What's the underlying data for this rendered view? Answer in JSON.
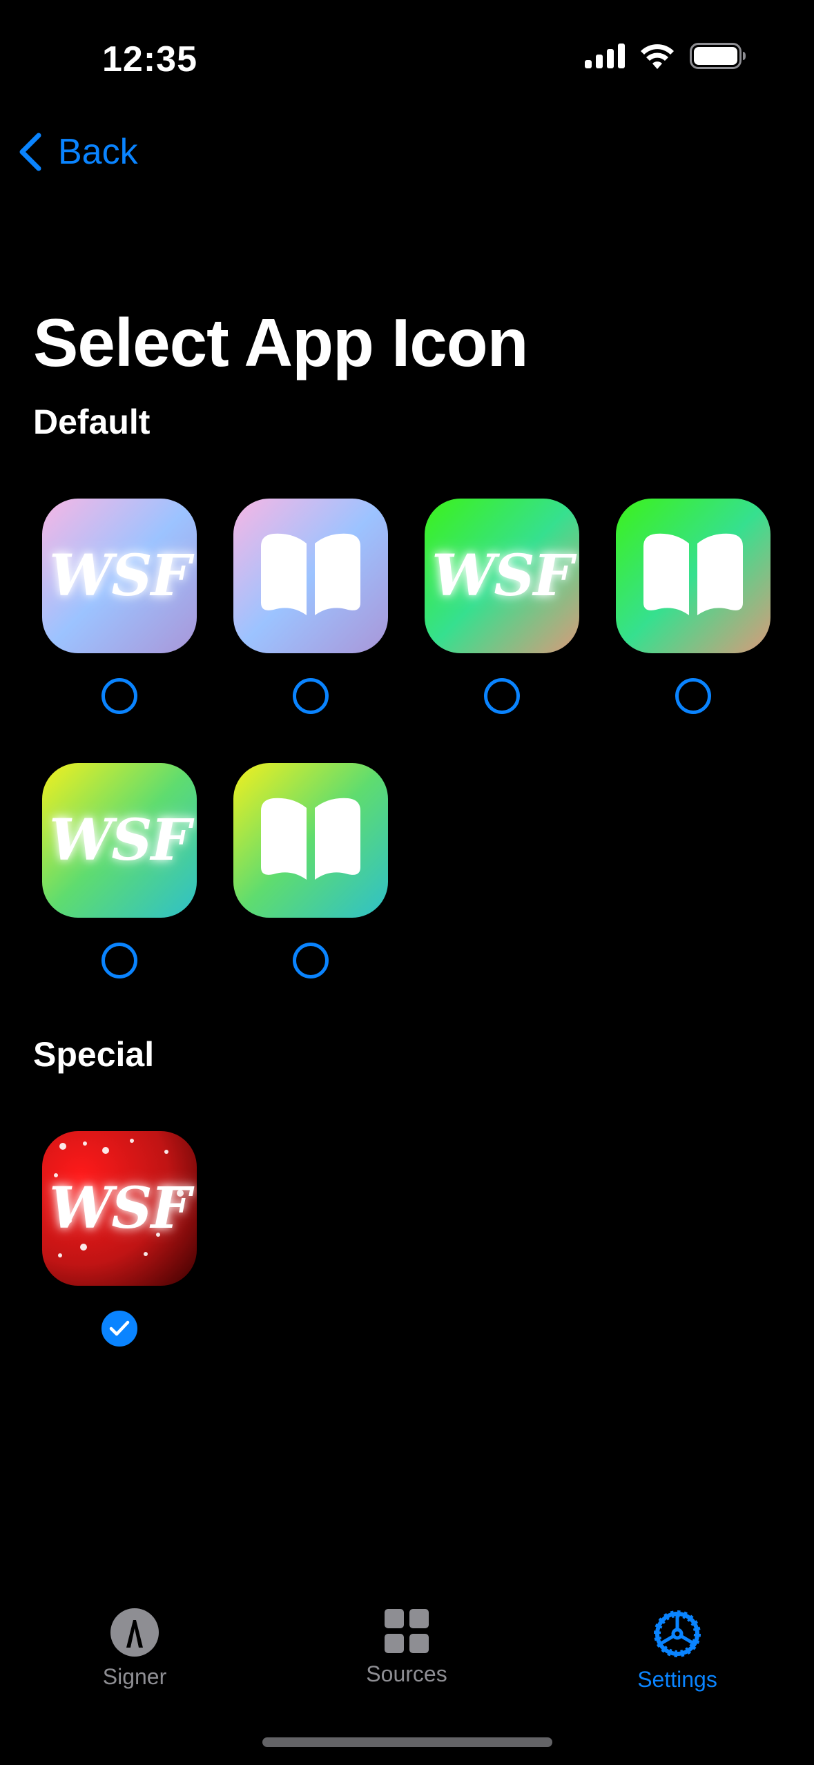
{
  "status": {
    "time": "12:35",
    "icons": [
      "cellular-signal-icon",
      "wifi-icon",
      "battery-icon"
    ]
  },
  "nav": {
    "back_label": "Back",
    "title": "Select App Icon"
  },
  "sections": [
    {
      "title": "Default",
      "icons": [
        {
          "kind": "wsf-text",
          "text": "WSF",
          "gradient": [
            "#f7b6e4",
            "#9cc3ff",
            "#a996d8"
          ],
          "selected": false
        },
        {
          "kind": "book",
          "gradient": [
            "#f7b6e4",
            "#9cc3ff",
            "#a996d8"
          ],
          "selected": false
        },
        {
          "kind": "wsf-text",
          "text": "WSF",
          "gradient": [
            "#3cf21a",
            "#36e08f",
            "#d99a7a"
          ],
          "selected": false
        },
        {
          "kind": "book",
          "gradient": [
            "#3cf21a",
            "#36e08f",
            "#d99a7a"
          ],
          "selected": false
        },
        {
          "kind": "wsf-text",
          "text": "WSF",
          "gradient": [
            "#f3f01e",
            "#5fdc6f",
            "#2fc0c9"
          ],
          "selected": false
        },
        {
          "kind": "book",
          "gradient": [
            "#f3f01e",
            "#5fdc6f",
            "#2fc0c9"
          ],
          "selected": false
        }
      ]
    },
    {
      "title": "Special",
      "icons": [
        {
          "kind": "wsf-text",
          "text": "WSF",
          "gradient": [
            "#ff1a1a",
            "#c01414",
            "#3a0000"
          ],
          "selected": true
        }
      ]
    }
  ],
  "tabbar": {
    "tabs": [
      {
        "label": "Signer",
        "icon": "signer-icon",
        "active": false
      },
      {
        "label": "Sources",
        "icon": "grid-icon",
        "active": false
      },
      {
        "label": "Settings",
        "icon": "gear-icon",
        "active": true
      }
    ]
  },
  "colors": {
    "accent": "#0a84ff",
    "background": "#000000",
    "inactive_tab": "#8e8e93"
  }
}
